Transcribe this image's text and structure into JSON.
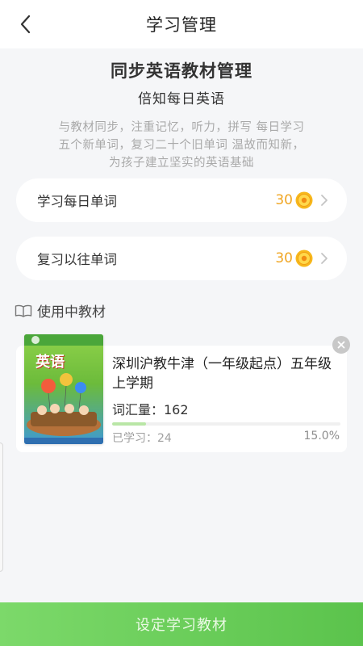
{
  "header": {
    "title": "学习管理",
    "back_icon": "back-arrow-icon"
  },
  "intro": {
    "title": "同步英语教材管理",
    "subtitle": "倍知每日英语",
    "description": "与教材同步，注重记忆，听力，拼写 每日学习五个新单词，复习二十个旧单词 温故而知新，为孩子建立坚实的英语基础"
  },
  "word_cards": [
    {
      "label": "学习每日单词",
      "count": "30",
      "icon": "coin-icon"
    },
    {
      "label": "复习以往单词",
      "count": "30",
      "icon": "coin-icon"
    }
  ],
  "section": {
    "title": "使用中教材",
    "icon": "book-icon"
  },
  "textbook": {
    "name": "深圳沪教牛津（一年级起点）五年级上学期",
    "vocab_label": "词汇量：162",
    "learned_label": "已学习：24",
    "percent_label": "15.0%",
    "progress": 0.15,
    "cover_title": "英语"
  },
  "bottom_button": {
    "label": "设定学习教材"
  },
  "colors": {
    "accent": "#5bc34c",
    "count": "#f0a623",
    "muted": "#a9a9a9"
  }
}
